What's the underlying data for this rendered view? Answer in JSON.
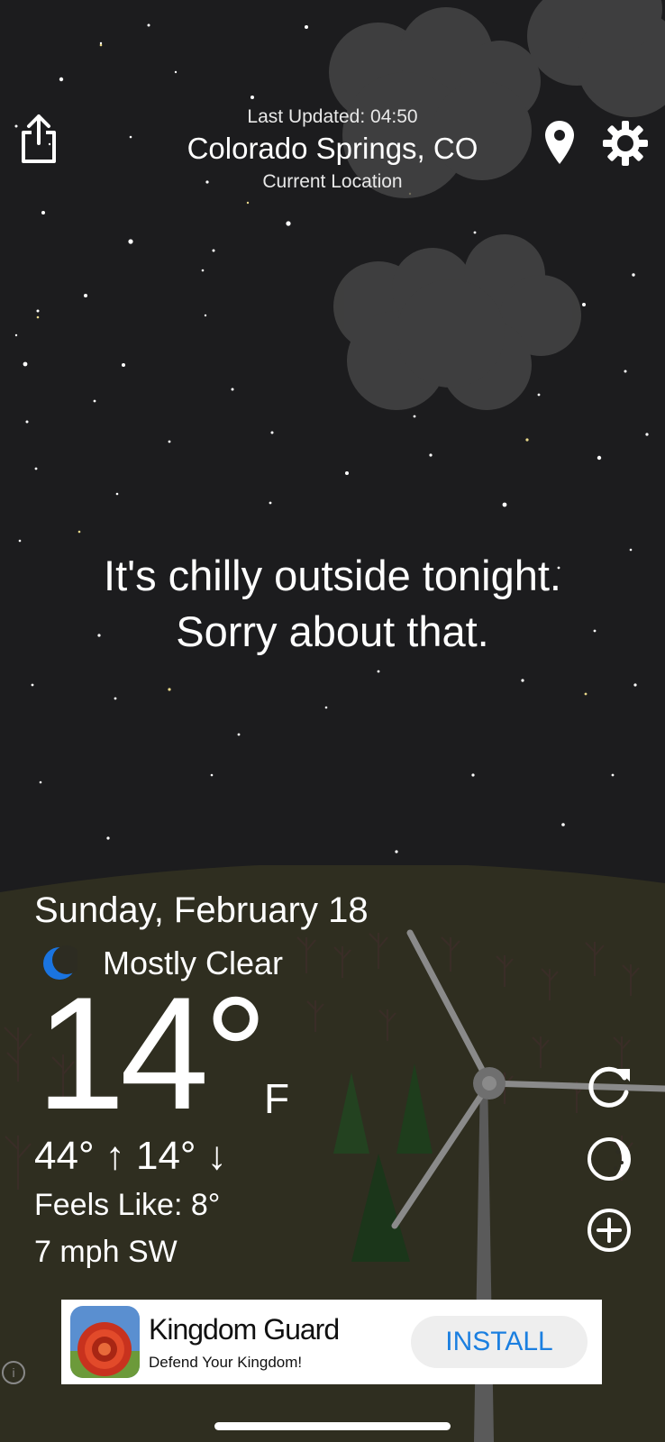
{
  "header": {
    "last_updated": "Last Updated: 04:50",
    "city": "Colorado Springs, CO",
    "location_label": "Current Location"
  },
  "message": {
    "line1": "It's chilly outside tonight.",
    "line2": "Sorry about that."
  },
  "weather": {
    "date": "Sunday, February 18",
    "condition": "Mostly Clear",
    "temperature": "14°",
    "unit": "F",
    "high_low": "44° ↑ 14° ↓",
    "feels_like": "Feels Like: 8°",
    "wind": "7 mph SW"
  },
  "ad": {
    "title": "Kingdom Guard",
    "subtitle": "Defend Your Kingdom!",
    "install_label": "INSTALL",
    "info_glyph": "i"
  },
  "icons": {
    "share": "share-icon",
    "location": "location-pin-icon",
    "settings": "gear-icon",
    "refresh": "refresh-icon",
    "moon_phase": "moon-phase-icon",
    "add": "add-icon",
    "condition": "crescent-moon-icon"
  },
  "colors": {
    "sky": "#1c1c1e",
    "ground": "#2f2e20",
    "moon_accent": "#1a74e0",
    "install_text": "#1b7fe0"
  }
}
